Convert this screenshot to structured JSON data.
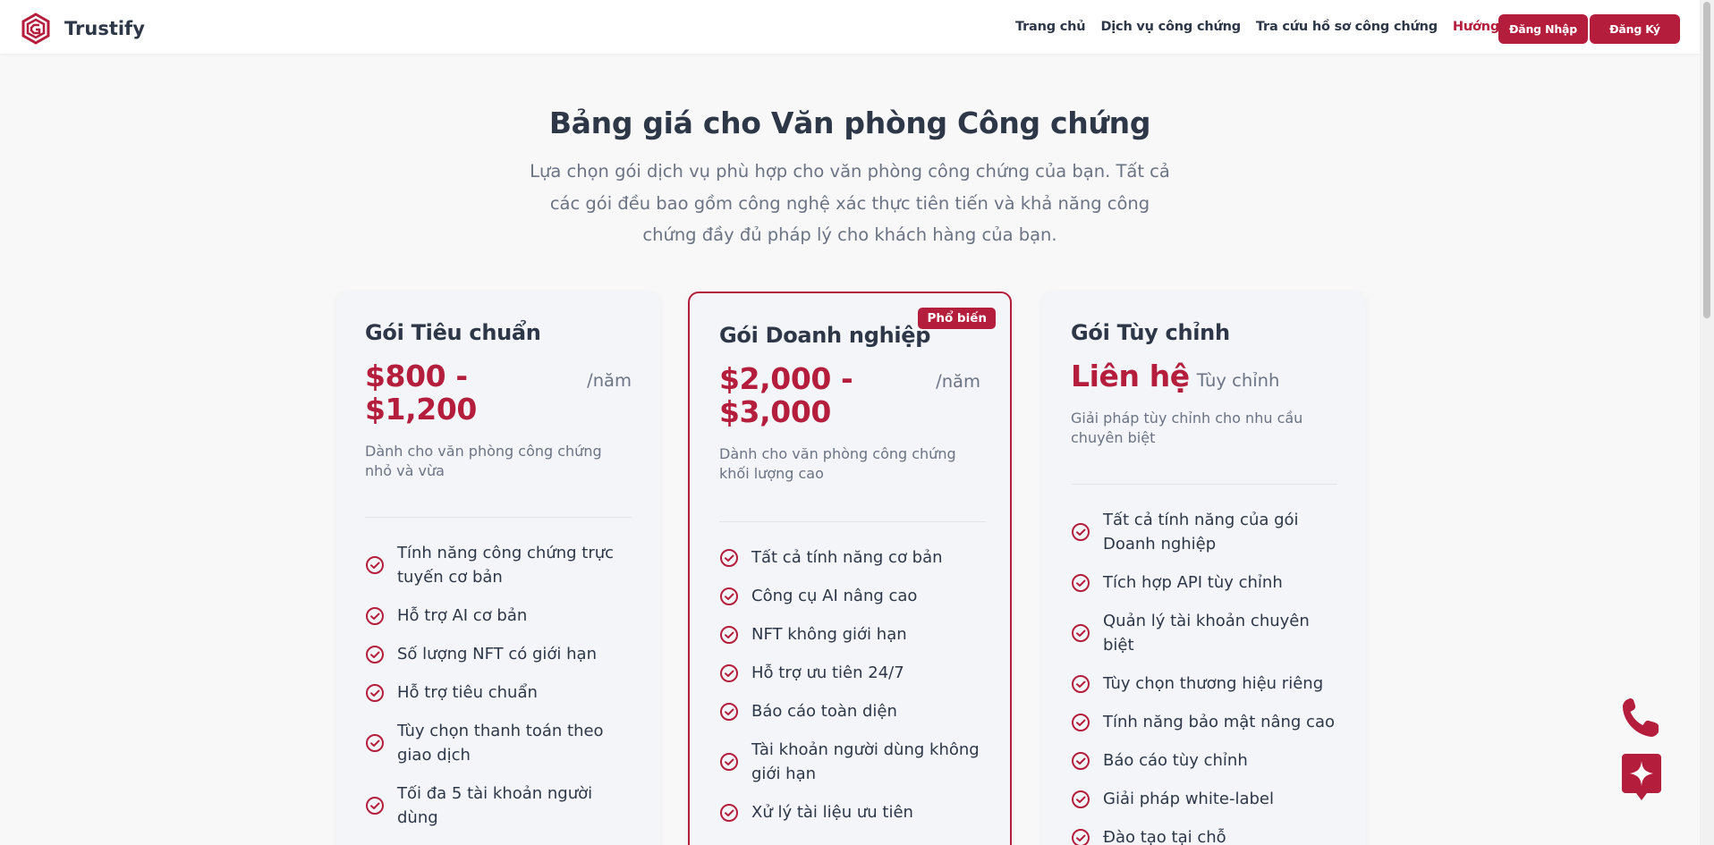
{
  "header": {
    "brand": "Trustify",
    "nav": [
      {
        "label": "Trang chủ"
      },
      {
        "label": "Dịch vụ công chứng"
      },
      {
        "label": "Tra cứu hồ sơ công chứng"
      },
      {
        "label": "Hướng dẫn"
      }
    ],
    "login_label": "Đăng Nhập",
    "register_label": "Đăng Ký"
  },
  "hero": {
    "title": "Bảng giá cho Văn phòng Công chứng",
    "subtitle": "Lựa chọn gói dịch vụ phù hợp cho văn phòng công chứng của bạn. Tất cả các gói đều bao gồm công nghệ xác thực tiên tiến và khả năng công chứng đầy đủ pháp lý cho khách hàng của bạn."
  },
  "plans": [
    {
      "title": "Gói Tiêu chuẩn",
      "price": "$800 - $1,200",
      "period": "/năm",
      "description": "Dành cho văn phòng công chứng nhỏ và vừa",
      "features": [
        "Tính năng công chứng trực tuyến cơ bản",
        "Hỗ trợ AI cơ bản",
        "Số lượng NFT có giới hạn",
        "Hỗ trợ tiêu chuẩn",
        "Tùy chọn thanh toán theo giao dịch",
        "Tối đa 5 tài khoản người dùng"
      ]
    },
    {
      "title": "Gói Doanh nghiệp",
      "badge": "Phổ biến",
      "price": "$2,000 - $3,000",
      "period": "/năm",
      "description": "Dành cho văn phòng công chứng khối lượng cao",
      "features": [
        "Tất cả tính năng cơ bản",
        "Công cụ AI nâng cao",
        "NFT không giới hạn",
        "Hỗ trợ ưu tiên 24/7",
        "Báo cáo toàn diện",
        "Tài khoản người dùng không giới hạn",
        "Xử lý tài liệu ưu tiên"
      ]
    },
    {
      "title": "Gói Tùy chỉnh",
      "price": "Liên hệ",
      "period": "Tùy chỉnh",
      "description": "Giải pháp tùy chỉnh cho nhu cầu chuyên biệt",
      "features": [
        "Tất cả tính năng của gói Doanh nghiệp",
        "Tích hợp API tùy chỉnh",
        "Quản lý tài khoản chuyên biệt",
        "Tùy chọn thương hiệu riêng",
        "Tính năng bảo mật nâng cao",
        "Báo cáo tùy chỉnh",
        "Giải pháp white-label",
        "Đào tạo tại chỗ"
      ]
    }
  ],
  "colors": {
    "accent": "#b41e3c",
    "text": "#2d3748",
    "muted": "#6b7384",
    "background": "#f8f8f9"
  },
  "icons": {
    "logo": "trustify-logo-icon",
    "check": "check-circle-icon",
    "phone": "phone-icon",
    "ai": "sparkle-chat-icon"
  }
}
